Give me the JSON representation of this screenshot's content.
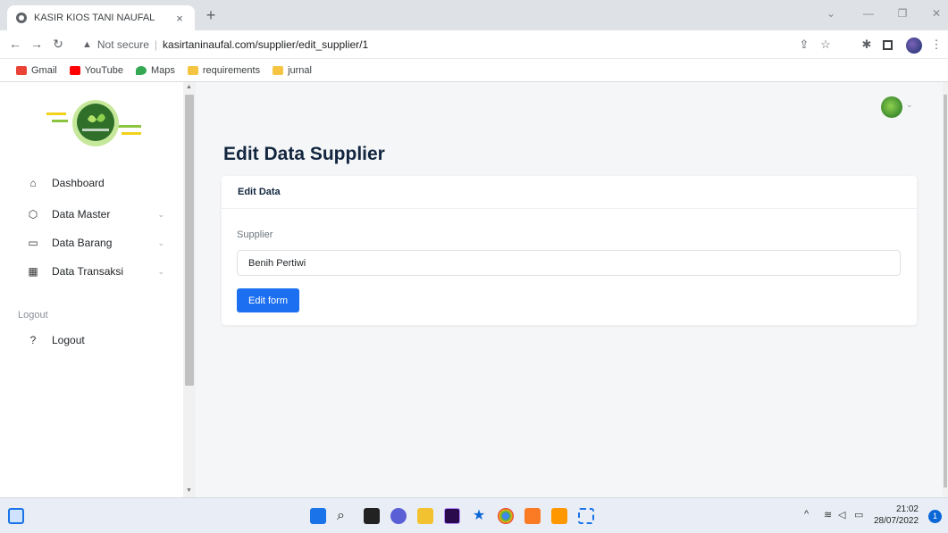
{
  "browser": {
    "tab_title": "KASIR KIOS TANI NAUFAL",
    "tab_close": "×",
    "new_tab": "+",
    "address": {
      "security_label": "Not secure",
      "url": "kasirtaninaufal.com/supplier/edit_supplier/1"
    },
    "bookmarks": [
      {
        "label": "Gmail",
        "icon": "gmail-icon",
        "color": "#ea4335"
      },
      {
        "label": "YouTube",
        "icon": "youtube-icon",
        "color": "#ff0000"
      },
      {
        "label": "Maps",
        "icon": "maps-icon",
        "color": "#34a853"
      },
      {
        "label": "requirements",
        "icon": "folder-icon",
        "color": "#f5c542"
      },
      {
        "label": "jurnal",
        "icon": "folder-icon",
        "color": "#f5c542"
      }
    ]
  },
  "sidebar": {
    "logo_alt": "KIOS TANI NAUFAL",
    "items": [
      {
        "label": "Dashboard",
        "icon": "home-icon",
        "has_chevron": false
      },
      {
        "label": "Data Master",
        "icon": "cube-icon",
        "has_chevron": true
      },
      {
        "label": "Data Barang",
        "icon": "card-icon",
        "has_chevron": true
      },
      {
        "label": "Data Transaksi",
        "icon": "grid-icon",
        "has_chevron": true
      }
    ],
    "section_label": "Logout",
    "logout_label": "Logout"
  },
  "main": {
    "page_title": "Edit Data Supplier",
    "card_title": "Edit Data",
    "field_label": "Supplier",
    "field_value": "Benih Pertiwi",
    "submit_label": "Edit form"
  },
  "taskbar": {
    "time": "21:02",
    "date": "28/07/2022",
    "notification_count": "1"
  },
  "colors": {
    "primary": "#1d6ff2",
    "title": "#12263f",
    "background": "#f5f6f8"
  }
}
